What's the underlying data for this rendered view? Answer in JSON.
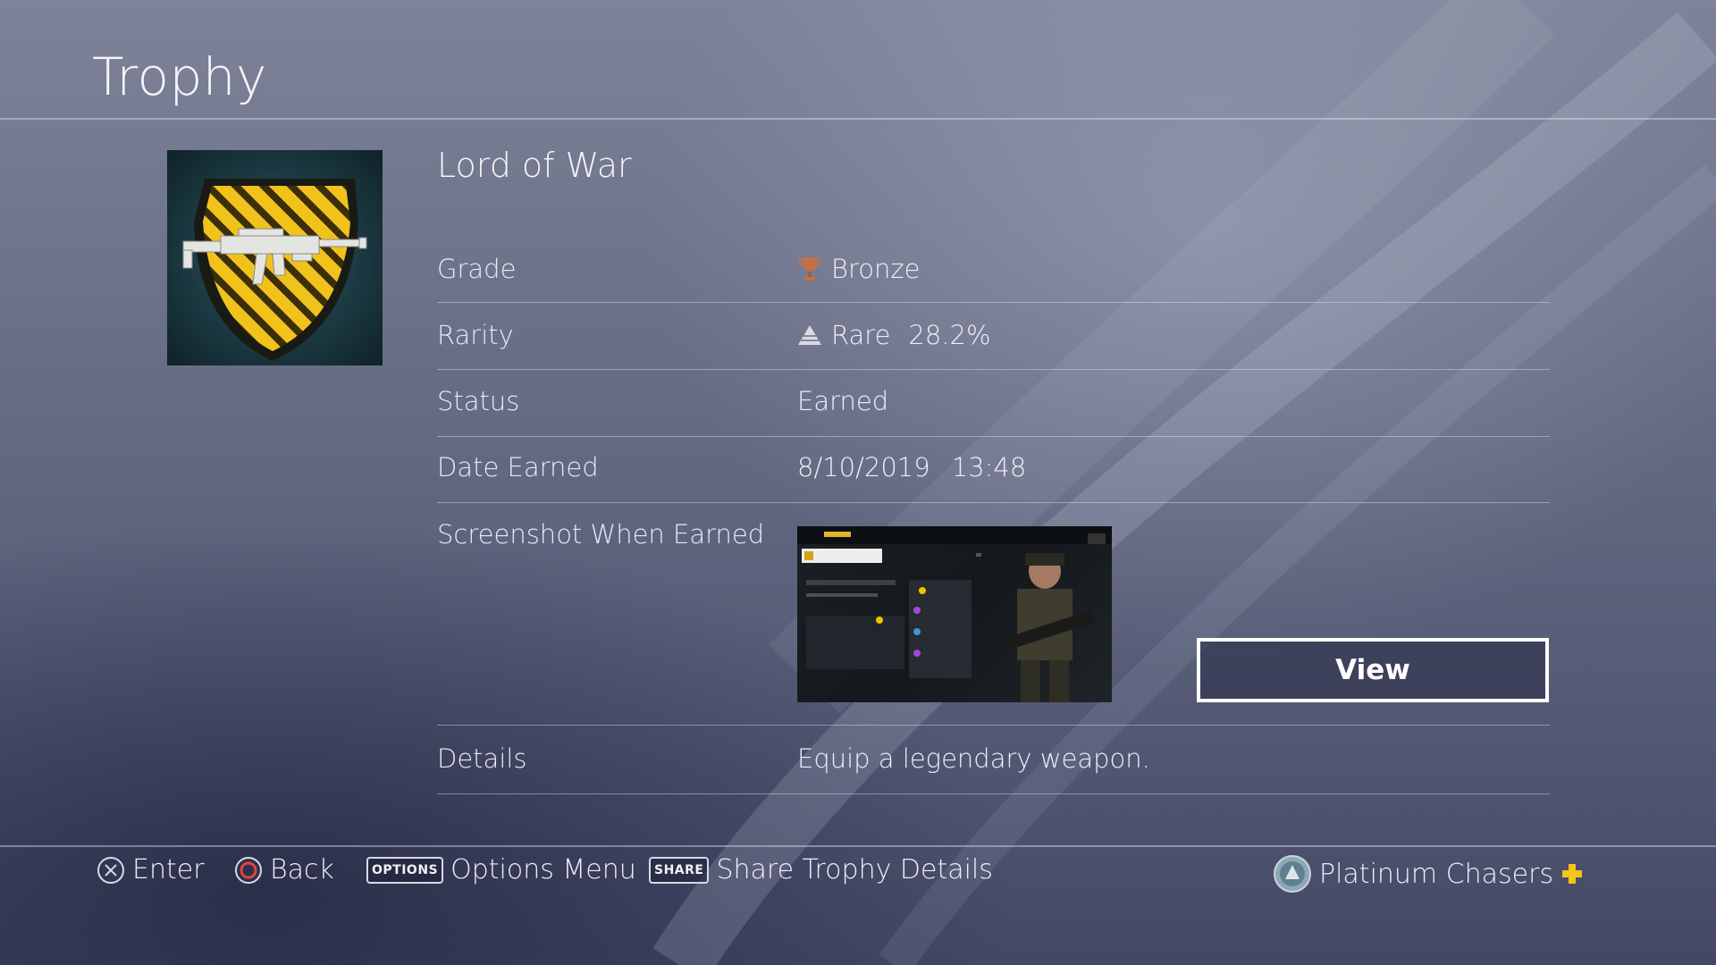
{
  "header": {
    "title": "Trophy"
  },
  "trophy": {
    "name": "Lord of War",
    "rows": [
      {
        "label": "Grade",
        "value": "Bronze",
        "icon": "bronze-trophy-icon"
      },
      {
        "label": "Rarity",
        "value": "Rare",
        "extra": "28.2%",
        "icon": "rarity-pyramid-icon"
      },
      {
        "label": "Status",
        "value": "Earned"
      },
      {
        "label": "Date Earned",
        "value": "8/10/2019",
        "extra": "13:48"
      },
      {
        "label": "Screenshot When Earned"
      },
      {
        "label": "Details",
        "value": "Equip a legendary weapon."
      }
    ],
    "view_button": "View"
  },
  "footer": {
    "hints": [
      {
        "icon": "cross-button-icon",
        "label": "Enter"
      },
      {
        "icon": "circle-button-icon",
        "label": "Back"
      },
      {
        "badge": "OPTIONS",
        "label": "Options Menu"
      },
      {
        "badge": "SHARE",
        "label": "Share Trophy Details"
      }
    ],
    "user": {
      "name": "Platinum Chasers",
      "icon": "avatar",
      "plus_icon": "ps-plus-icon"
    }
  },
  "colors": {
    "bronze": "#c0714a",
    "plus": "#f5c518",
    "accent_yellow": "#f2c200"
  }
}
